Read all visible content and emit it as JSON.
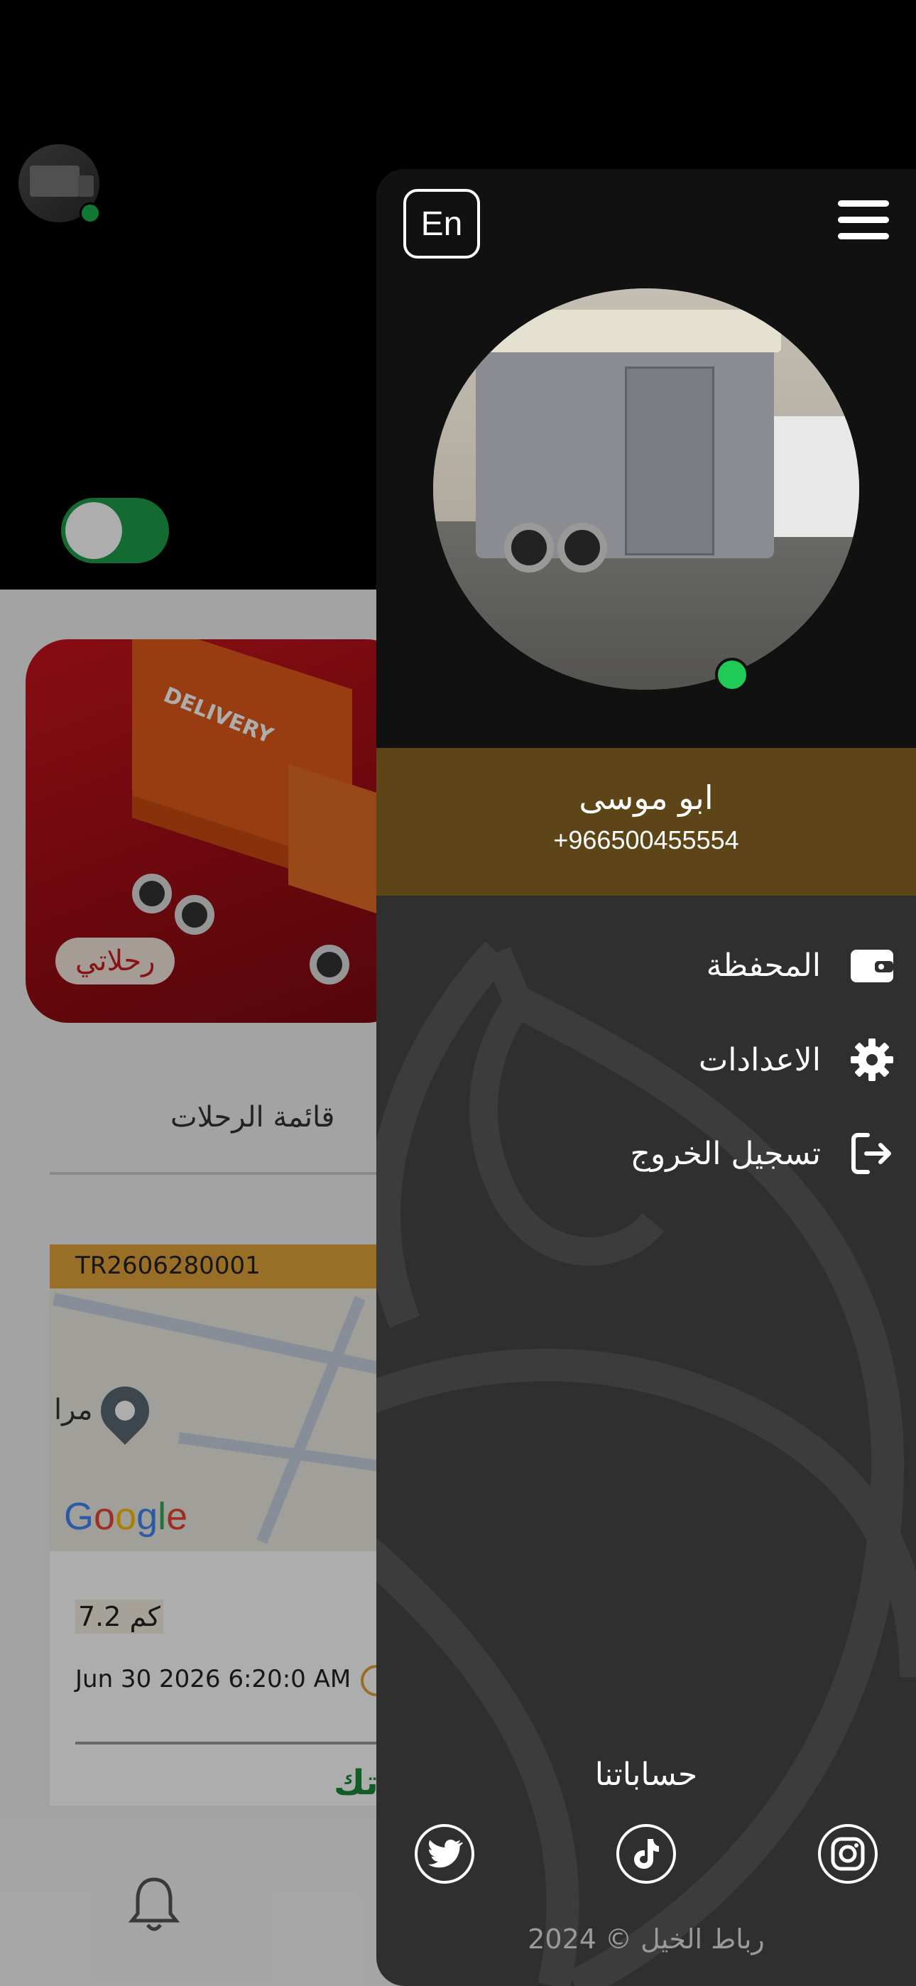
{
  "background": {
    "banner_chip": "رحلاتي",
    "trips_title": "قائمة الرحلات",
    "trip": {
      "id": "TR2606280001",
      "map_label": "مرا",
      "distance": "7.2 كم",
      "datetime": "Jun 30 2026 6:20:0 AM",
      "action": "تك",
      "map_brand": "Google"
    },
    "banner_text": "DELIVERY",
    "online_toggle_on": true
  },
  "drawer": {
    "language_button": "En",
    "user": {
      "name": "ابو موسى",
      "phone": "+966500455554",
      "online": true
    },
    "menu": [
      {
        "label": "المحفظة",
        "icon": "wallet-icon"
      },
      {
        "label": "الاعدادات",
        "icon": "gear-icon"
      },
      {
        "label": "تسجيل الخروج",
        "icon": "logout-icon"
      }
    ],
    "socials_title": "حساباتنا",
    "socials": [
      "twitter-icon",
      "tiktok-icon",
      "instagram-icon"
    ],
    "copyright": {
      "year": "2024",
      "symbol": "©",
      "owner": "رباط الخيل"
    }
  },
  "colors": {
    "accent_brown": "#5e4518",
    "online_green": "#1fca57",
    "toggle_green": "#1e9e4a",
    "banner_red": "#c9141e",
    "trip_header": "#e2a23a"
  }
}
